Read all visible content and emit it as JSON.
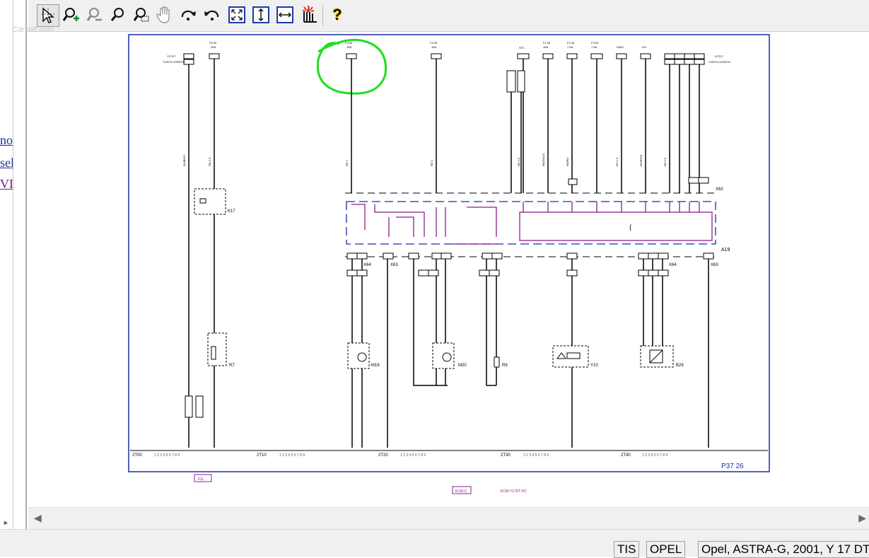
{
  "toolbar": {
    "tools": [
      {
        "name": "select-tool-button",
        "icon": "pointer-icon"
      },
      {
        "name": "zoom-in-button",
        "icon": "zoom-in-icon"
      },
      {
        "name": "zoom-out-button",
        "icon": "zoom-out-icon"
      },
      {
        "name": "zoom-button",
        "icon": "magnifier-icon"
      },
      {
        "name": "zoom-window-button",
        "icon": "zoom-window-icon"
      },
      {
        "name": "pan-button",
        "icon": "hand-icon"
      },
      {
        "name": "rotate-right-button",
        "icon": "rotate-right-icon"
      },
      {
        "name": "rotate-left-button",
        "icon": "rotate-left-icon"
      },
      {
        "name": "fit-page-button",
        "icon": "fit-page-icon"
      },
      {
        "name": "fit-height-button",
        "icon": "fit-height-icon"
      },
      {
        "name": "fit-width-button",
        "icon": "fit-width-icon"
      },
      {
        "name": "highlight-button",
        "icon": "highlight-icon"
      },
      {
        "name": "help-button",
        "icon": "help-icon"
      }
    ],
    "help_label": "?"
  },
  "sidebar": {
    "links": [
      "nor",
      "sel",
      "VD"
    ]
  },
  "diagram": {
    "drawing_id": "P37 26",
    "module_label": "A19",
    "connector_labels": [
      "X64",
      "X63",
      "X64",
      "X63",
      "X62"
    ],
    "component_labels": [
      "K17",
      "R7",
      "M19",
      "M20",
      "R9",
      "Y10",
      "B29"
    ],
    "tracks": [
      "2T00",
      "2T10",
      "2T20",
      "2T30",
      "2T40"
    ],
    "foot_refs": [
      "F1L",
      "ECM-C"
    ],
    "highlight_color": "#22dd22",
    "wire_color": "#000000",
    "module_color": "#8b1f8b",
    "frame_color": "#1a2fa0"
  },
  "status": {
    "app": "TIS",
    "brand": "OPEL",
    "vehicle": "Opel, ASTRA-G, 2001, Y 17 DT"
  },
  "colors": {
    "accent": "#1a2fa0",
    "highlight": "#22dd22"
  }
}
